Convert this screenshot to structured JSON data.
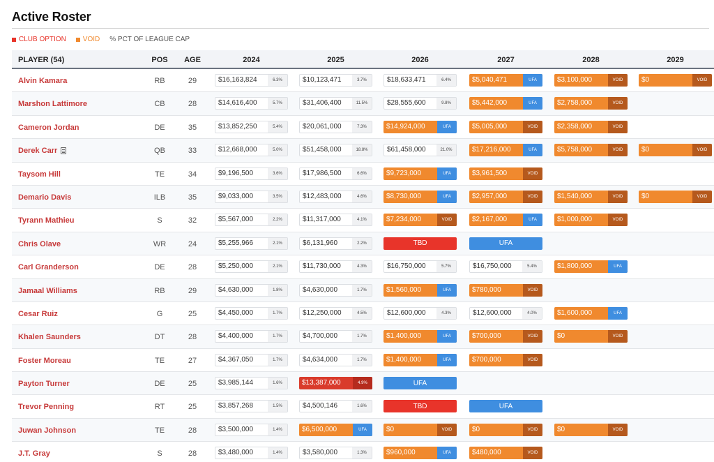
{
  "title": "Active Roster",
  "legend": {
    "club_option": "CLUB OPTION",
    "void": "VOID",
    "pct": "% PCT OF LEAGUE CAP"
  },
  "colors": {
    "club_option": "#e8342a",
    "void": "#f0892e",
    "ufa": "#3f8ee0",
    "void_tag": "#b5591d",
    "player_name": "#c73a3a"
  },
  "headers": {
    "player": "PLAYER (54)",
    "pos": "POS",
    "age": "AGE",
    "years": [
      "2024",
      "2025",
      "2026",
      "2027",
      "2028",
      "2029"
    ]
  },
  "rows": [
    {
      "name": "Alvin Kamara",
      "pos": "RB",
      "age": "29",
      "cells": [
        {
          "t": "plain",
          "amt": "$16,163,824",
          "pct": "6.3%"
        },
        {
          "t": "plain",
          "amt": "$10,123,471",
          "pct": "3.7%"
        },
        {
          "t": "plain",
          "amt": "$18,633,471",
          "pct": "6.4%"
        },
        {
          "t": "ufa",
          "amt": "$5,040,471",
          "tag": "UFA"
        },
        {
          "t": "void",
          "amt": "$3,100,000",
          "tag": "VOID"
        },
        {
          "t": "void",
          "amt": "$0",
          "tag": "VOID"
        }
      ]
    },
    {
      "name": "Marshon Lattimore",
      "pos": "CB",
      "age": "28",
      "cells": [
        {
          "t": "plain",
          "amt": "$14,616,400",
          "pct": "5.7%"
        },
        {
          "t": "plain",
          "amt": "$31,406,400",
          "pct": "11.5%"
        },
        {
          "t": "plain",
          "amt": "$28,555,600",
          "pct": "9.8%"
        },
        {
          "t": "ufa",
          "amt": "$5,442,000",
          "tag": "UFA"
        },
        {
          "t": "void",
          "amt": "$2,758,000",
          "tag": "VOID"
        },
        null
      ]
    },
    {
      "name": "Cameron Jordan",
      "pos": "DE",
      "age": "35",
      "cells": [
        {
          "t": "plain",
          "amt": "$13,852,250",
          "pct": "5.4%"
        },
        {
          "t": "plain",
          "amt": "$20,061,000",
          "pct": "7.3%"
        },
        {
          "t": "ufa",
          "amt": "$14,924,000",
          "tag": "UFA"
        },
        {
          "t": "void",
          "amt": "$5,005,000",
          "tag": "VOID"
        },
        {
          "t": "void",
          "amt": "$2,358,000",
          "tag": "VOID"
        },
        null
      ]
    },
    {
      "name": "Derek Carr",
      "doc": true,
      "pos": "QB",
      "age": "33",
      "cells": [
        {
          "t": "plain",
          "amt": "$12,668,000",
          "pct": "5.0%"
        },
        {
          "t": "plain",
          "amt": "$51,458,000",
          "pct": "18.8%"
        },
        {
          "t": "plain",
          "amt": "$61,458,000",
          "pct": "21.0%"
        },
        {
          "t": "ufa",
          "amt": "$17,216,000",
          "tag": "UFA"
        },
        {
          "t": "void",
          "amt": "$5,758,000",
          "tag": "VOID"
        },
        {
          "t": "void",
          "amt": "$0",
          "tag": "VOID"
        }
      ]
    },
    {
      "name": "Taysom Hill",
      "pos": "TE",
      "age": "34",
      "cells": [
        {
          "t": "plain",
          "amt": "$9,196,500",
          "pct": "3.6%"
        },
        {
          "t": "plain",
          "amt": "$17,986,500",
          "pct": "6.6%"
        },
        {
          "t": "ufa",
          "amt": "$9,723,000",
          "tag": "UFA"
        },
        {
          "t": "void",
          "amt": "$3,961,500",
          "tag": "VOID"
        },
        null,
        null
      ]
    },
    {
      "name": "Demario Davis",
      "pos": "ILB",
      "age": "35",
      "cells": [
        {
          "t": "plain",
          "amt": "$9,033,000",
          "pct": "3.5%"
        },
        {
          "t": "plain",
          "amt": "$12,483,000",
          "pct": "4.6%"
        },
        {
          "t": "ufa",
          "amt": "$8,730,000",
          "tag": "UFA"
        },
        {
          "t": "void",
          "amt": "$2,957,000",
          "tag": "VOID"
        },
        {
          "t": "void",
          "amt": "$1,540,000",
          "tag": "VOID"
        },
        {
          "t": "void",
          "amt": "$0",
          "tag": "VOID"
        }
      ]
    },
    {
      "name": "Tyrann Mathieu",
      "pos": "S",
      "age": "32",
      "cells": [
        {
          "t": "plain",
          "amt": "$5,567,000",
          "pct": "2.2%"
        },
        {
          "t": "plain",
          "amt": "$11,317,000",
          "pct": "4.1%"
        },
        {
          "t": "void",
          "amt": "$7,234,000",
          "tag": "VOID"
        },
        {
          "t": "ufa",
          "amt": "$2,167,000",
          "tag": "UFA"
        },
        {
          "t": "void",
          "amt": "$1,000,000",
          "tag": "VOID"
        },
        null
      ]
    },
    {
      "name": "Chris Olave",
      "pos": "WR",
      "age": "24",
      "cells": [
        {
          "t": "plain",
          "amt": "$5,255,966",
          "pct": "2.1%"
        },
        {
          "t": "plain",
          "amt": "$6,131,960",
          "pct": "2.2%"
        },
        {
          "t": "tbd",
          "amt": "TBD"
        },
        {
          "t": "ufafull",
          "amt": "UFA"
        },
        null,
        null
      ]
    },
    {
      "name": "Carl Granderson",
      "pos": "DE",
      "age": "28",
      "cells": [
        {
          "t": "plain",
          "amt": "$5,250,000",
          "pct": "2.1%"
        },
        {
          "t": "plain",
          "amt": "$11,730,000",
          "pct": "4.3%"
        },
        {
          "t": "plain",
          "amt": "$16,750,000",
          "pct": "5.7%"
        },
        {
          "t": "plain",
          "amt": "$16,750,000",
          "pct": "5.4%"
        },
        {
          "t": "ufa",
          "amt": "$1,800,000",
          "tag": "UFA"
        },
        null
      ]
    },
    {
      "name": "Jamaal Williams",
      "pos": "RB",
      "age": "29",
      "cells": [
        {
          "t": "plain",
          "amt": "$4,630,000",
          "pct": "1.8%"
        },
        {
          "t": "plain",
          "amt": "$4,630,000",
          "pct": "1.7%"
        },
        {
          "t": "ufa",
          "amt": "$1,560,000",
          "tag": "UFA"
        },
        {
          "t": "void",
          "amt": "$780,000",
          "tag": "VOID"
        },
        null,
        null
      ]
    },
    {
      "name": "Cesar Ruiz",
      "pos": "G",
      "age": "25",
      "cells": [
        {
          "t": "plain",
          "amt": "$4,450,000",
          "pct": "1.7%"
        },
        {
          "t": "plain",
          "amt": "$12,250,000",
          "pct": "4.5%"
        },
        {
          "t": "plain",
          "amt": "$12,600,000",
          "pct": "4.3%"
        },
        {
          "t": "plain",
          "amt": "$12,600,000",
          "pct": "4.0%"
        },
        {
          "t": "ufa",
          "amt": "$1,600,000",
          "tag": "UFA"
        },
        null
      ]
    },
    {
      "name": "Khalen Saunders",
      "pos": "DT",
      "age": "28",
      "cells": [
        {
          "t": "plain",
          "amt": "$4,400,000",
          "pct": "1.7%"
        },
        {
          "t": "plain",
          "amt": "$4,700,000",
          "pct": "1.7%"
        },
        {
          "t": "ufa",
          "amt": "$1,400,000",
          "tag": "UFA"
        },
        {
          "t": "void",
          "amt": "$700,000",
          "tag": "VOID"
        },
        {
          "t": "void",
          "amt": "$0",
          "tag": "VOID"
        },
        null
      ]
    },
    {
      "name": "Foster Moreau",
      "pos": "TE",
      "age": "27",
      "cells": [
        {
          "t": "plain",
          "amt": "$4,367,050",
          "pct": "1.7%"
        },
        {
          "t": "plain",
          "amt": "$4,634,000",
          "pct": "1.7%"
        },
        {
          "t": "ufa",
          "amt": "$1,400,000",
          "tag": "UFA"
        },
        {
          "t": "void",
          "amt": "$700,000",
          "tag": "VOID"
        },
        null,
        null
      ]
    },
    {
      "name": "Payton Turner",
      "pos": "DE",
      "age": "25",
      "cells": [
        {
          "t": "plain",
          "amt": "$3,985,144",
          "pct": "1.6%"
        },
        {
          "t": "red",
          "amt": "$13,387,000",
          "pct": "4.9%"
        },
        {
          "t": "ufafull",
          "amt": "UFA"
        },
        null,
        null,
        null
      ]
    },
    {
      "name": "Trevor Penning",
      "pos": "RT",
      "age": "25",
      "cells": [
        {
          "t": "plain",
          "amt": "$3,857,268",
          "pct": "1.5%"
        },
        {
          "t": "plain",
          "amt": "$4,500,146",
          "pct": "1.6%"
        },
        {
          "t": "tbd",
          "amt": "TBD"
        },
        {
          "t": "ufafull",
          "amt": "UFA"
        },
        null,
        null
      ]
    },
    {
      "name": "Juwan Johnson",
      "pos": "TE",
      "age": "28",
      "cells": [
        {
          "t": "plain",
          "amt": "$3,500,000",
          "pct": "1.4%"
        },
        {
          "t": "ufa",
          "amt": "$6,500,000",
          "tag": "UFA"
        },
        {
          "t": "void",
          "amt": "$0",
          "tag": "VOID"
        },
        {
          "t": "void",
          "amt": "$0",
          "tag": "VOID"
        },
        {
          "t": "void",
          "amt": "$0",
          "tag": "VOID"
        },
        null
      ]
    },
    {
      "name": "J.T. Gray",
      "pos": "S",
      "age": "28",
      "cells": [
        {
          "t": "plain",
          "amt": "$3,480,000",
          "pct": "1.4%"
        },
        {
          "t": "plain",
          "amt": "$3,580,000",
          "pct": "1.3%"
        },
        {
          "t": "ufa",
          "amt": "$960,000",
          "tag": "UFA"
        },
        {
          "t": "void",
          "amt": "$480,000",
          "tag": "VOID"
        },
        null,
        null
      ]
    }
  ]
}
